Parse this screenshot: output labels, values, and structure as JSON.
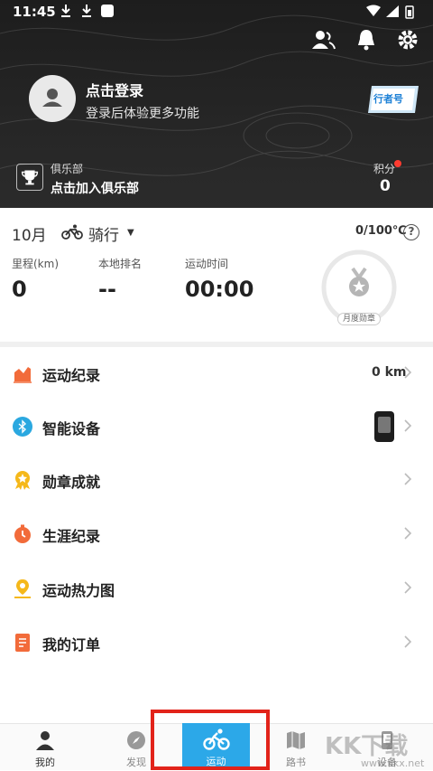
{
  "status_bar": {
    "time": "11:45"
  },
  "profile": {
    "login_title": "点击登录",
    "login_subtitle": "登录后体验更多功能",
    "walker_badge": "行者号"
  },
  "club": {
    "name": "俱乐部",
    "join": "点击加入俱乐部"
  },
  "points": {
    "label": "积分",
    "value": "0"
  },
  "summary": {
    "month": "10月",
    "sport": "骑行",
    "goal": "0/100℃",
    "stats": [
      {
        "label": "里程(km)",
        "value": "0"
      },
      {
        "label": "本地排名",
        "value": "--"
      },
      {
        "label": "运动时间",
        "value": "00:00"
      }
    ],
    "medal_label": "月度勋章"
  },
  "menu": [
    {
      "label": "运动纪录",
      "value": "0 km",
      "icon": "chart-icon",
      "color": "#f26b3a"
    },
    {
      "label": "智能设备",
      "icon": "bluetooth-icon",
      "color": "#2aa8e0"
    },
    {
      "label": "勋章成就",
      "icon": "medal-icon",
      "color": "#f5b81a"
    },
    {
      "label": "生涯纪录",
      "icon": "stopwatch-icon",
      "color": "#f26b3a"
    },
    {
      "label": "运动热力图",
      "icon": "location-icon",
      "color": "#f5b81a"
    },
    {
      "label": "我的订单",
      "icon": "order-icon",
      "color": "#f26b3a"
    }
  ],
  "bottom_nav": [
    {
      "label": "我的",
      "icon": "person-icon",
      "active": false
    },
    {
      "label": "发现",
      "icon": "compass-icon",
      "active": false
    },
    {
      "label": "运动",
      "icon": "bike-icon",
      "active": true
    },
    {
      "label": "路书",
      "icon": "map-icon",
      "active": false
    },
    {
      "label": "设备",
      "icon": "device-icon",
      "active": false
    }
  ],
  "watermark": {
    "main": "KK下载",
    "sub": "www.kkx.net"
  },
  "colors": {
    "header_bg": "#232323",
    "accent": "#2ca8e8",
    "highlight_box": "#e2231a"
  }
}
